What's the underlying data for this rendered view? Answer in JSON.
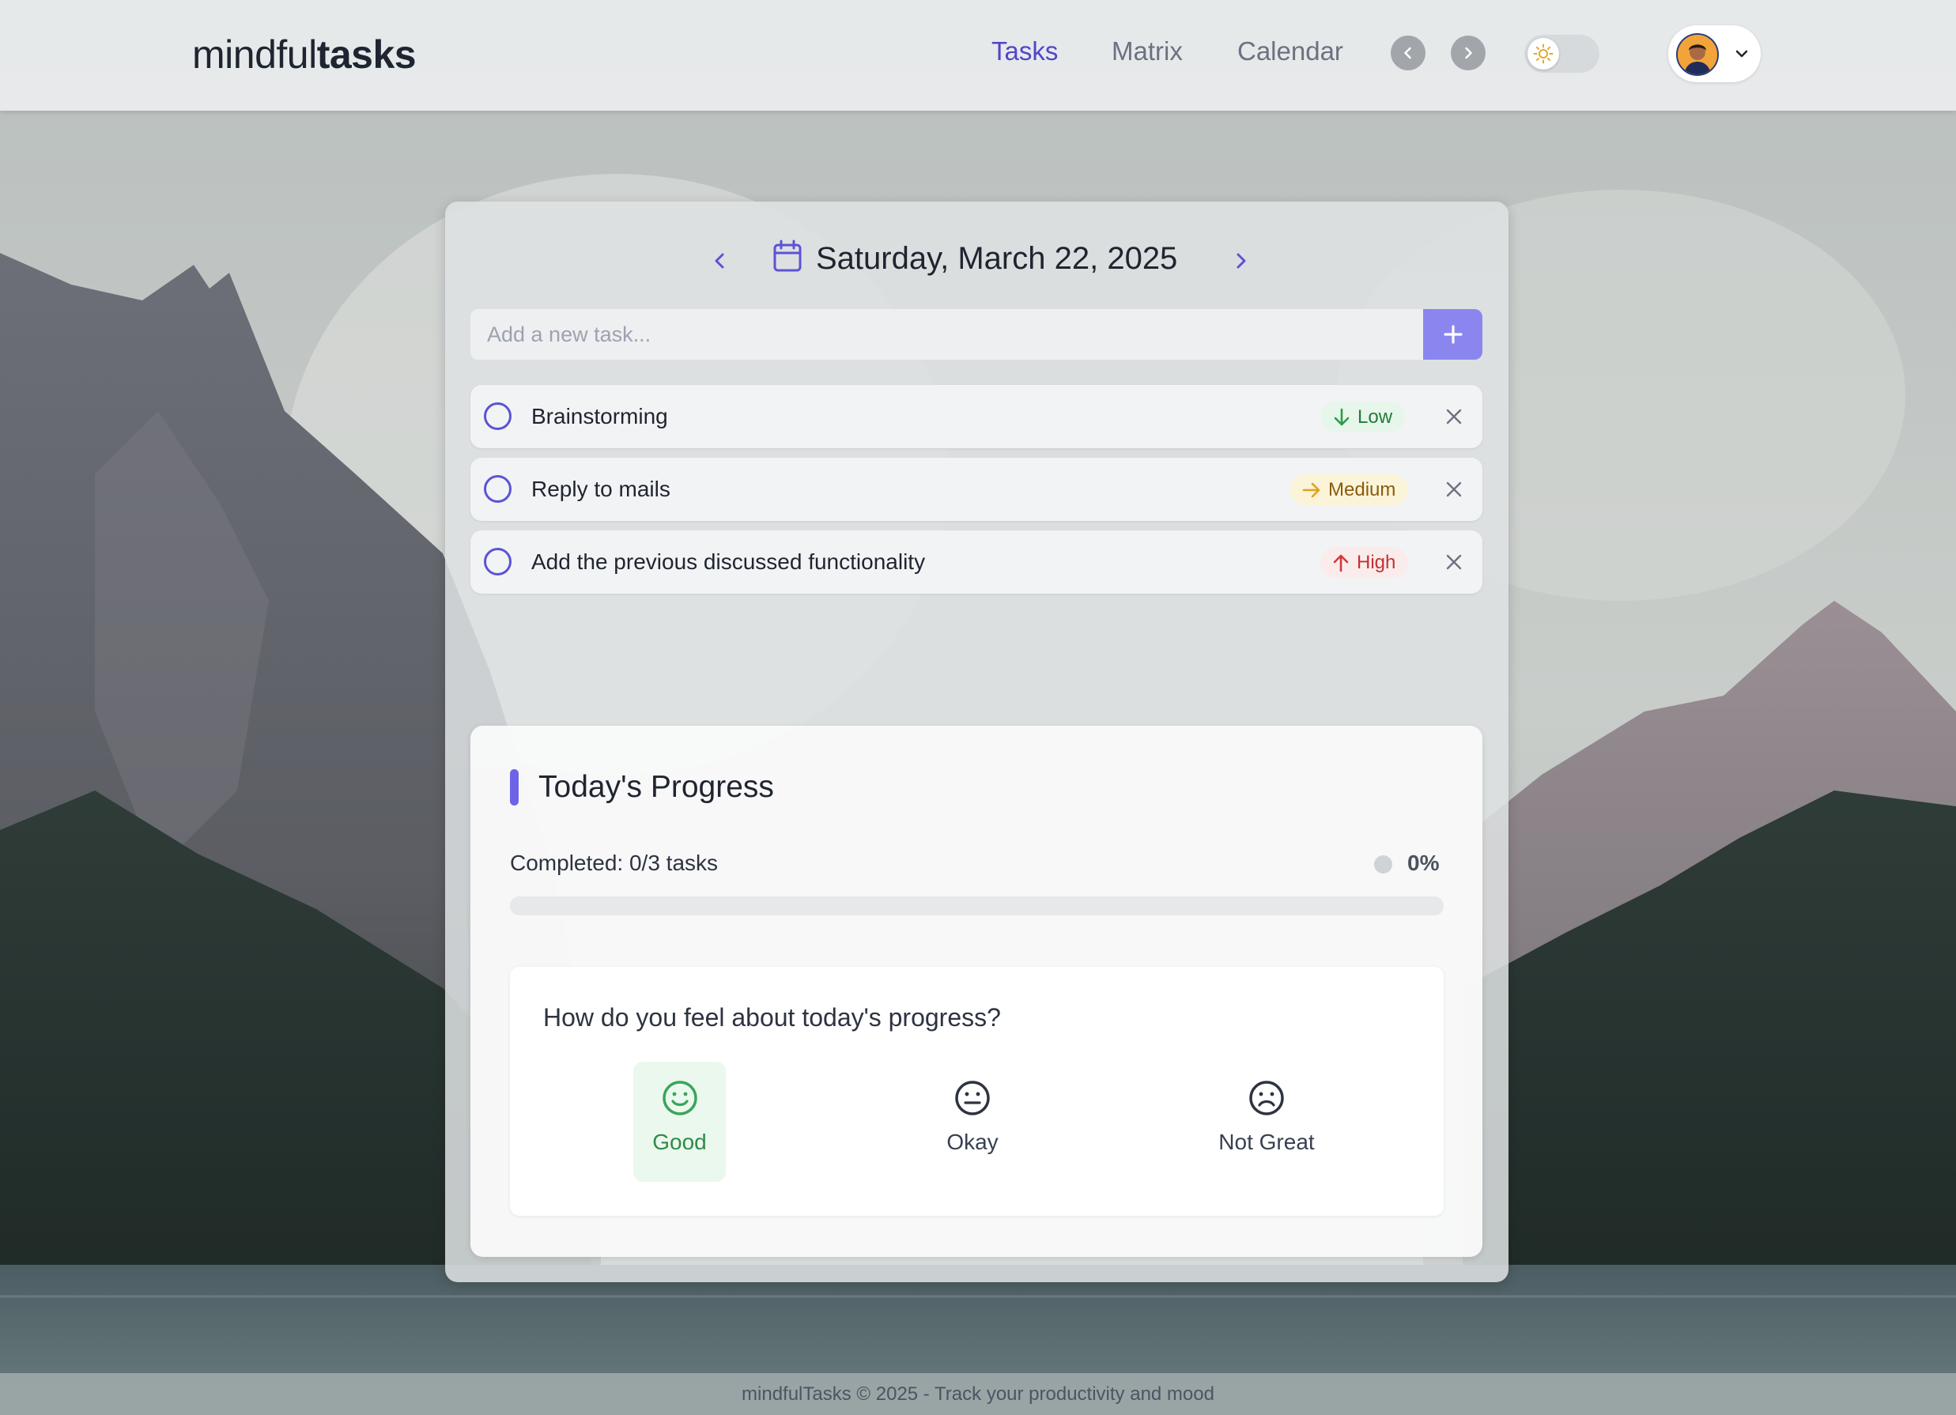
{
  "app": {
    "logo_light": "mindful",
    "logo_bold": "tasks"
  },
  "nav": {
    "items": [
      {
        "label": "Tasks",
        "active": true
      },
      {
        "label": "Matrix",
        "active": false
      },
      {
        "label": "Calendar",
        "active": false
      }
    ]
  },
  "date": {
    "label": "Saturday, March 22, 2025"
  },
  "add_task": {
    "placeholder": "Add a new task...",
    "value": ""
  },
  "tasks": [
    {
      "title": "Brainstorming",
      "priority": "Low",
      "completed": false
    },
    {
      "title": "Reply to mails",
      "priority": "Medium",
      "completed": false
    },
    {
      "title": "Add the previous discussed functionality",
      "priority": "High",
      "completed": false
    }
  ],
  "progress": {
    "title": "Today's Progress",
    "completed_text": "Completed: 0/3 tasks",
    "percent_text": "0%",
    "fraction": 0
  },
  "mood": {
    "question": "How do you feel about today's progress?",
    "options": [
      {
        "label": "Good",
        "selected": true
      },
      {
        "label": "Okay",
        "selected": false
      },
      {
        "label": "Not Great",
        "selected": false
      }
    ]
  },
  "footer": {
    "text": "mindfulTasks © 2025 - Track your productivity and mood"
  },
  "colors": {
    "accent": "#5b53d6",
    "add_button": "#8b86ef",
    "low": "#24793b",
    "medium": "#8a5b0e",
    "high": "#c53030"
  },
  "icons": {
    "date_prev": "chevron-left-icon",
    "date_next": "chevron-right-icon",
    "calendar": "calendar-icon",
    "add": "plus-icon",
    "low": "arrow-down-icon",
    "medium": "arrow-right-icon",
    "high": "arrow-up-icon",
    "delete": "close-icon",
    "theme": "sun-icon",
    "user_menu": "chevron-down-icon"
  }
}
